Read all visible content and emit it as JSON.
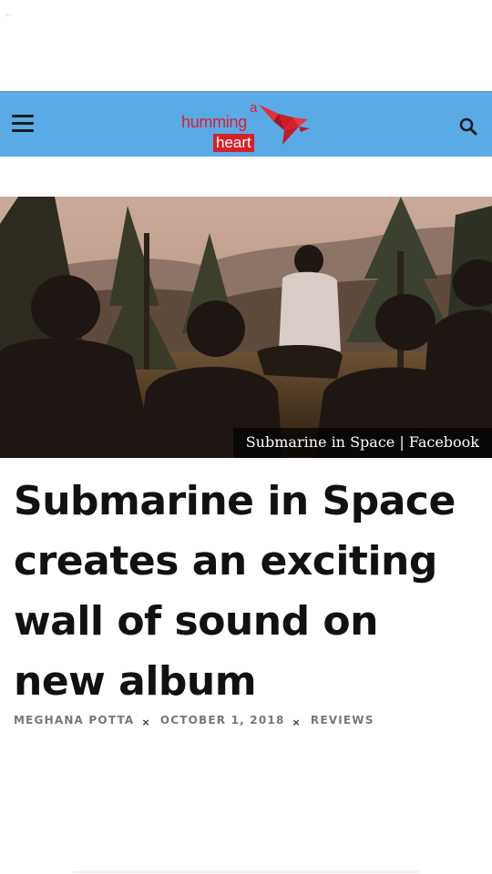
{
  "header": {
    "logo": {
      "small_word": "a",
      "word1": "humming",
      "word2": "heart",
      "brand_color": "#d5222a"
    },
    "bar_color": "#5aaae6",
    "menu_icon": "hamburger-menu-icon",
    "search_icon": "search-icon"
  },
  "status": {
    "back_glyph": "←"
  },
  "hero": {
    "caption": "Submarine in Space | Facebook"
  },
  "article": {
    "title": "Submarine in Space creates an exciting wall of sound on new album",
    "author": "MEGHANA POTTA",
    "date": "OCTOBER 1, 2018",
    "category": "REVIEWS",
    "separator": "×"
  }
}
